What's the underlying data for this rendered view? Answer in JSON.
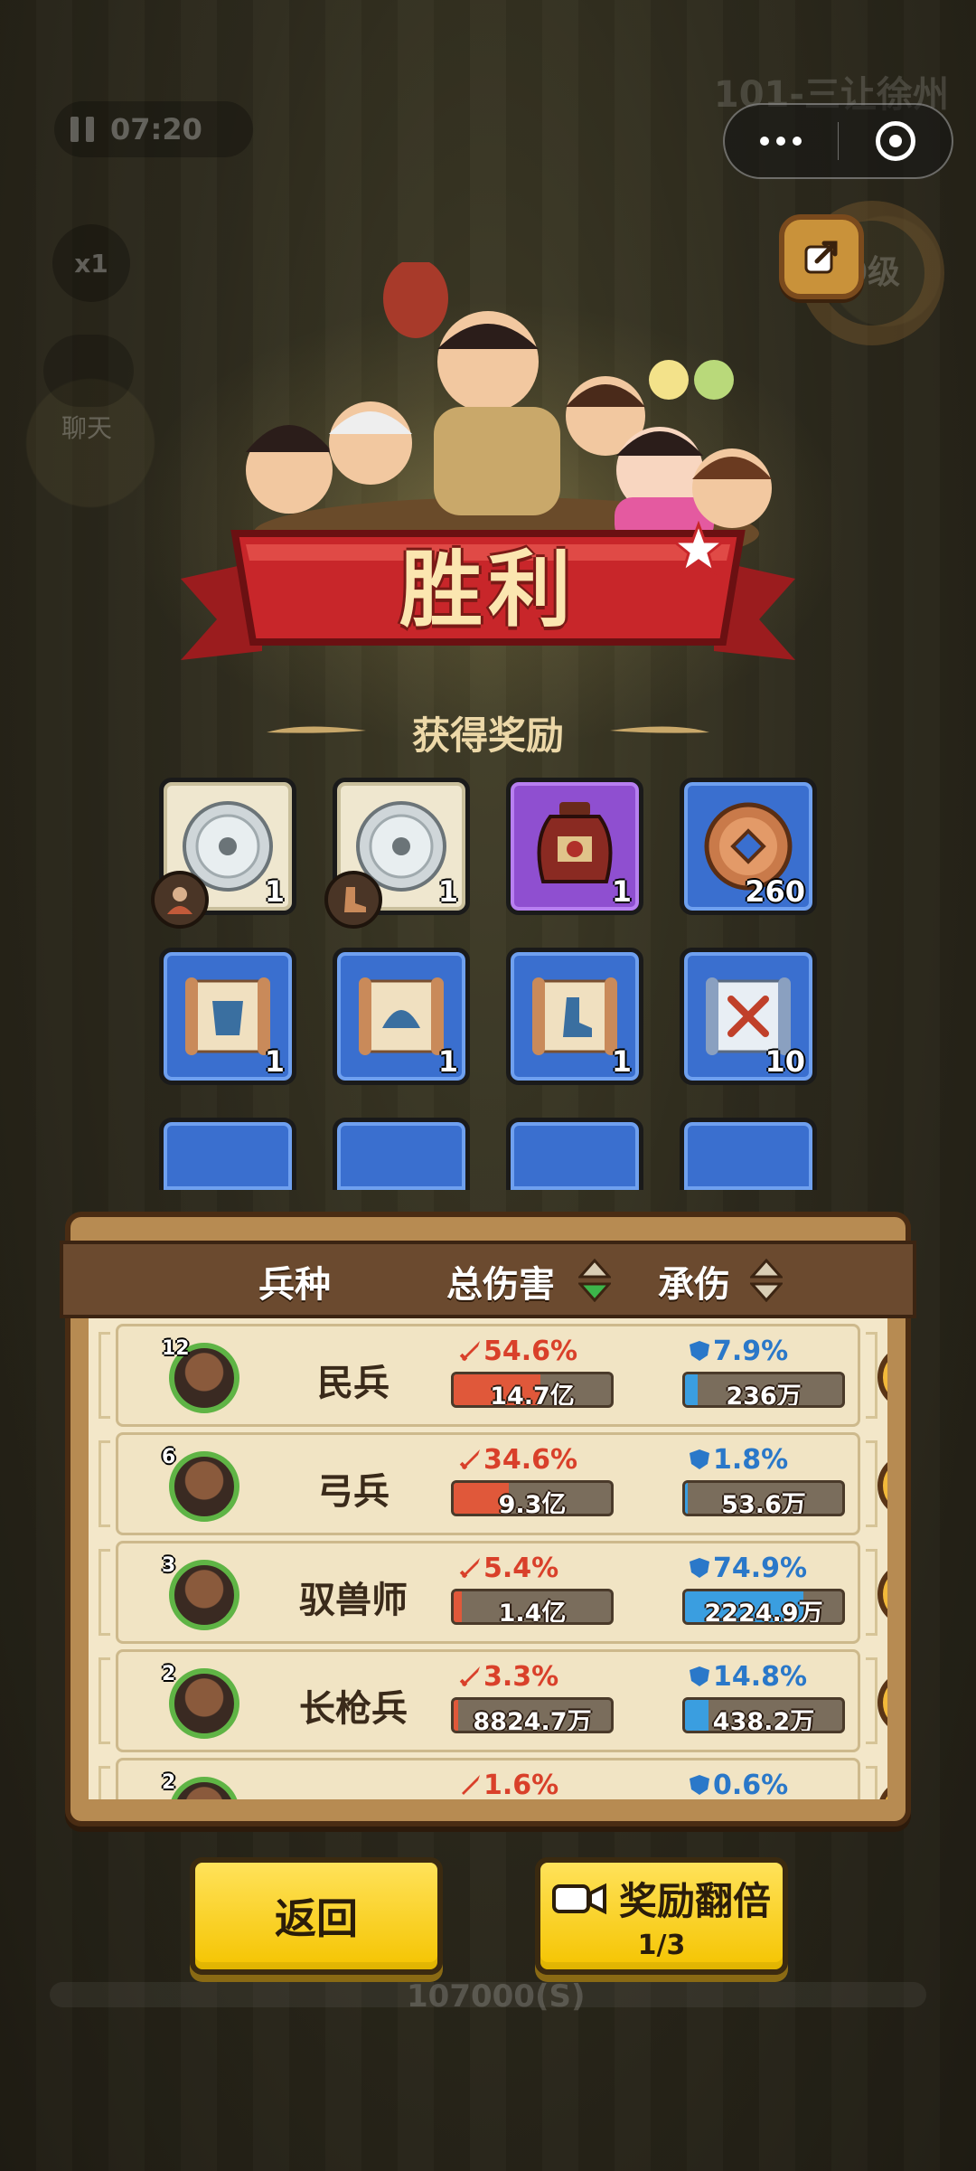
{
  "status": {
    "timer": "07:20",
    "speed": "x1",
    "chat_label": "聊天",
    "level_title": "101-三让徐州",
    "level_badge": "0级"
  },
  "victory": {
    "title": "胜利",
    "reward_heading": "获得奖励"
  },
  "rewards": [
    {
      "icon": "silver-disc-icon",
      "rarity": "white",
      "qty": "1",
      "badge_icon": "warrior-badge-icon"
    },
    {
      "icon": "silver-disc-icon",
      "rarity": "white",
      "qty": "1",
      "badge_icon": "boot-badge-icon"
    },
    {
      "icon": "wine-jar-icon",
      "rarity": "purple",
      "qty": "1"
    },
    {
      "icon": "copper-coin-icon",
      "rarity": "blue",
      "qty": "260"
    },
    {
      "icon": "scroll-armor-icon",
      "rarity": "blue",
      "qty": "1"
    },
    {
      "icon": "scroll-helmet-icon",
      "rarity": "blue",
      "qty": "1"
    },
    {
      "icon": "scroll-boot-icon",
      "rarity": "blue",
      "qty": "1"
    },
    {
      "icon": "scroll-swords-icon",
      "rarity": "blue",
      "qty": "10"
    }
  ],
  "stats": {
    "headers": {
      "unit": "兵种",
      "damage": "总伤害",
      "taken": "承伤"
    },
    "rows": [
      {
        "level": "12",
        "name": "民兵",
        "dmg_pct": "54.6%",
        "dmg_value": "14.7亿",
        "dmg_fill": 0.55,
        "taken_pct": "7.9%",
        "taken_value": "236万",
        "taken_fill": 0.08
      },
      {
        "level": "6",
        "name": "弓兵",
        "dmg_pct": "34.6%",
        "dmg_value": "9.3亿",
        "dmg_fill": 0.35,
        "taken_pct": "1.8%",
        "taken_value": "53.6万",
        "taken_fill": 0.02
      },
      {
        "level": "3",
        "name": "驭兽师",
        "dmg_pct": "5.4%",
        "dmg_value": "1.4亿",
        "dmg_fill": 0.05,
        "taken_pct": "74.9%",
        "taken_value": "2224.9万",
        "taken_fill": 0.75
      },
      {
        "level": "2",
        "name": "长枪兵",
        "dmg_pct": "3.3%",
        "dmg_value": "8824.7万",
        "dmg_fill": 0.03,
        "taken_pct": "14.8%",
        "taken_value": "438.2万",
        "taken_fill": 0.15
      },
      {
        "level": "2",
        "name": "",
        "dmg_pct": "1.6%",
        "dmg_value": "",
        "dmg_fill": 0.02,
        "taken_pct": "0.6%",
        "taken_value": "",
        "taken_fill": 0.01
      }
    ]
  },
  "buttons": {
    "back": "返回",
    "double_label": "奖励翻倍",
    "double_count": "1/3"
  },
  "bottom_text": "107000(S)",
  "colors": {
    "accent_yellow": "#f5c400",
    "damage_red": "#e0583a",
    "taken_blue": "#3a9ee0",
    "banner_red": "#c8262a"
  }
}
